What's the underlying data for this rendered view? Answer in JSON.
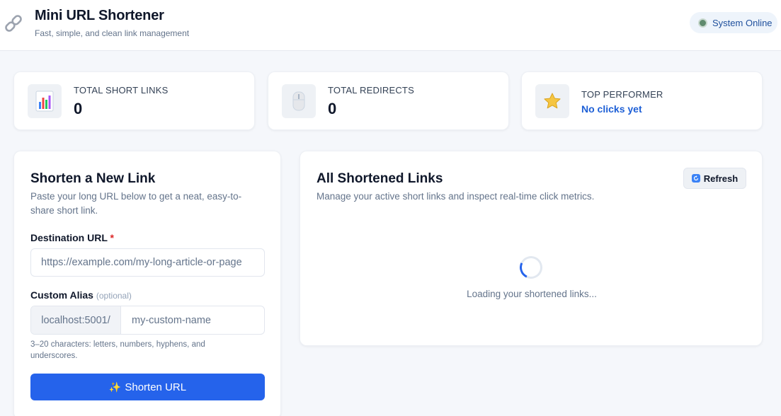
{
  "header": {
    "title": "Mini URL Shortener",
    "subtitle": "Fast, simple, and clean link management",
    "status": "System Online",
    "status_color": "#5f8a6e"
  },
  "stats": [
    {
      "label": "TOTAL SHORT LINKS",
      "value": "0",
      "icon": "bar-chart-icon"
    },
    {
      "label": "TOTAL REDIRECTS",
      "value": "0",
      "icon": "mouse-icon"
    },
    {
      "label": "TOP PERFORMER",
      "value": "No clicks yet",
      "icon": "star-icon"
    }
  ],
  "form": {
    "title": "Shorten a New Link",
    "description": "Paste your long URL below to get a neat, easy-to-share short link.",
    "destination_label": "Destination URL",
    "required_mark": "*",
    "destination_placeholder": "https://example.com/my-long-article-or-page",
    "alias_label": "Custom Alias",
    "alias_optional": "(optional)",
    "alias_prefix": "localhost:5001/",
    "alias_placeholder": "my-custom-name",
    "hint": "3–20 characters: letters, numbers, hyphens, and underscores.",
    "submit_label": "Shorten URL"
  },
  "links": {
    "title": "All Shortened Links",
    "description": "Manage your active short links and inspect real-time click metrics.",
    "refresh_label": "Refresh",
    "loading_text": "Loading your shortened links..."
  },
  "colors": {
    "accent": "#2563eb",
    "link": "#1d5fd6",
    "required": "#dc2626"
  }
}
